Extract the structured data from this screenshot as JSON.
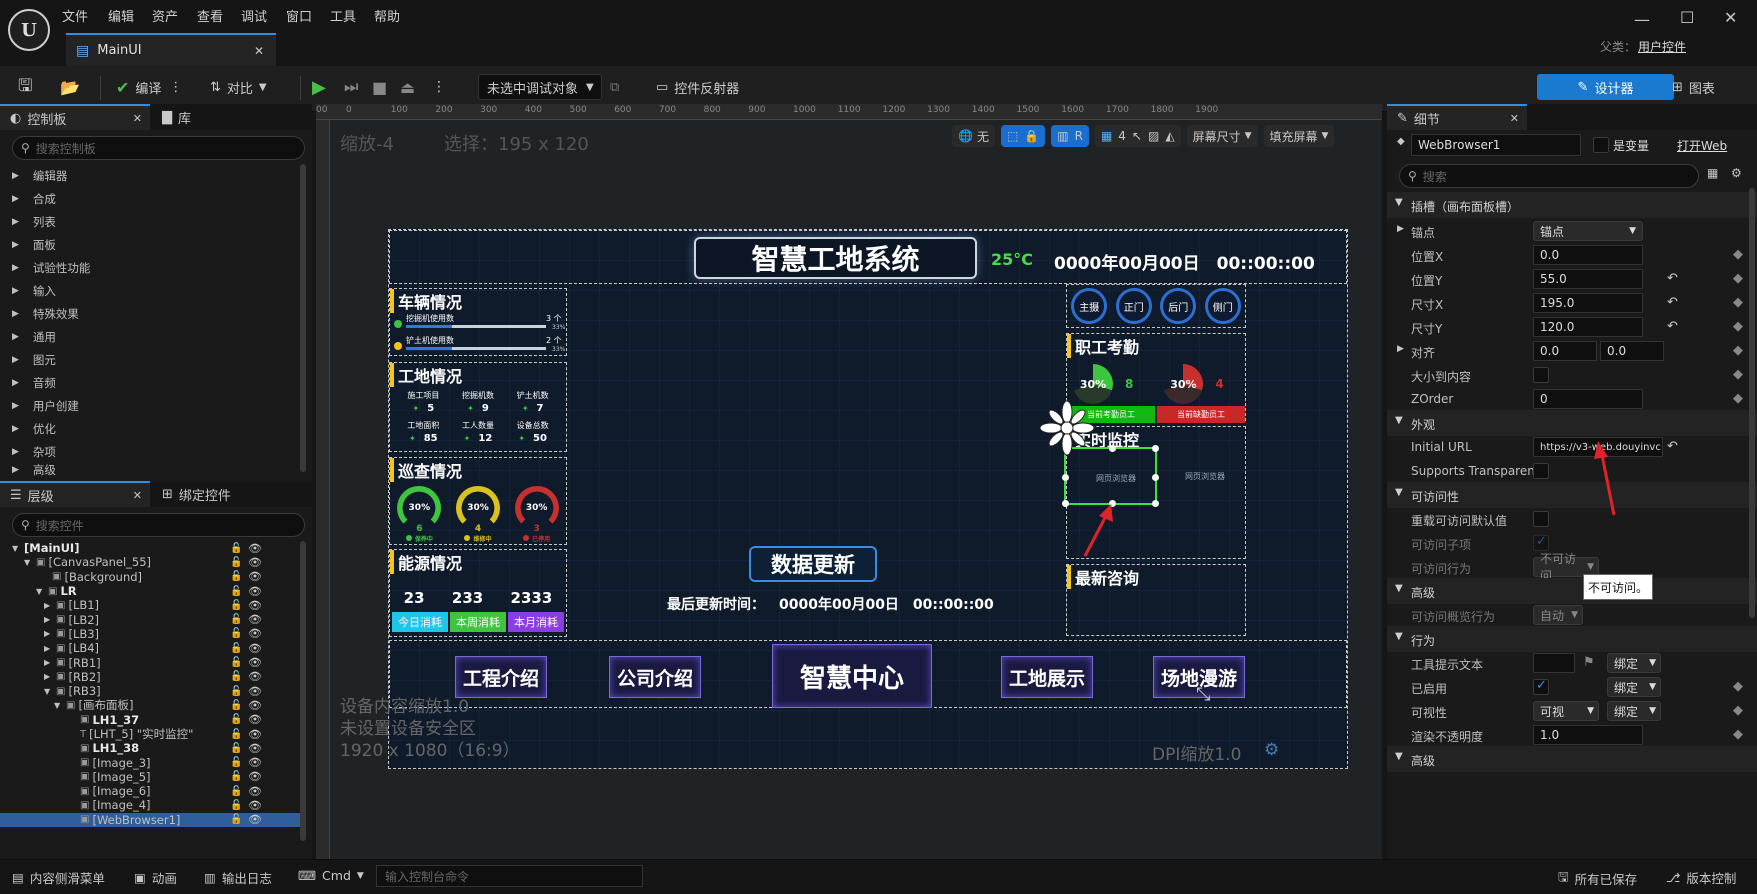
{
  "menu": {
    "items": [
      "文件",
      "编辑",
      "资产",
      "查看",
      "调试",
      "窗口",
      "工具",
      "帮助"
    ],
    "parent_label": "父类：",
    "parent_value": "用户控件",
    "window_controls": [
      "minimize",
      "maximize",
      "close"
    ]
  },
  "tab": {
    "label": "MainUI"
  },
  "toolbar": {
    "compile": "编译",
    "diff": "对比",
    "debug_select": "未选中调试对象",
    "widget_reflector": "控件反射器",
    "designer": "设计器",
    "graph": "图表"
  },
  "palette": {
    "tab_palette": "控制板",
    "tab_library": "库",
    "search_placeholder": "搜索控制板",
    "categories": [
      "编辑器",
      "合成",
      "列表",
      "面板",
      "试验性功能",
      "输入",
      "特殊效果",
      "通用",
      "图元",
      "音频",
      "用户创建",
      "优化",
      "杂项",
      "高级"
    ]
  },
  "hierarchy": {
    "tab_hierarchy": "层级",
    "tab_bind": "绑定控件",
    "search_placeholder": "搜索控件",
    "rows": [
      {
        "label": "[MainUI]",
        "bold": true
      },
      {
        "label": "[CanvasPanel_55]"
      },
      {
        "label": "[Background]"
      },
      {
        "label": "LR",
        "bold": true
      },
      {
        "label": "[LB1]"
      },
      {
        "label": "[LB2]"
      },
      {
        "label": "[LB3]"
      },
      {
        "label": "[LB4]"
      },
      {
        "label": "[RB1]"
      },
      {
        "label": "[RB2]"
      },
      {
        "label": "[RB3]"
      },
      {
        "label": "[画布面板]"
      },
      {
        "label": "LH1_37",
        "bold": true
      },
      {
        "label": "[LHT_5] \"实时监控\""
      },
      {
        "label": "LH1_38",
        "bold": true
      },
      {
        "label": "[Image_3]"
      },
      {
        "label": "[Image_5]"
      },
      {
        "label": "[Image_6]"
      },
      {
        "label": "[Image_4]"
      },
      {
        "label": "[WebBrowser1]"
      }
    ]
  },
  "viewport": {
    "zoom": "缩放-4",
    "selection": "选择：195 x 120",
    "ruler_ticks": [
      "00",
      "0",
      "100",
      "200",
      "300",
      "400",
      "500",
      "600",
      "700",
      "800",
      "900",
      "1000",
      "1100",
      "1200",
      "1300",
      "1400",
      "1500",
      "1600",
      "1700",
      "1800",
      "1900"
    ],
    "toolbar_none": "无",
    "toolbar_r": "R",
    "toolbar_grid": "4",
    "screen_size": "屏幕尺寸",
    "fill_screen": "填充屏幕",
    "info_lines": [
      "设备内容缩放1.0",
      "未设置设备安全区",
      "1920 x 1080（16:9）"
    ],
    "dpi": "DPI缩放1.0"
  },
  "design": {
    "title": "智慧工地系统",
    "temp": "25°C",
    "datetime": "0000年00月00日　00::00::00",
    "vehicles": {
      "title": "车辆情况",
      "items": [
        {
          "label": "挖掘机使用数",
          "count": "3 个",
          "pct": "33%",
          "fill": 0.33
        },
        {
          "label": "铲土机使用数",
          "count": "2 个",
          "pct": "33%",
          "fill": 0.33
        }
      ]
    },
    "site": {
      "title": "工地情况",
      "items": [
        {
          "label": "施工项目",
          "value": "5"
        },
        {
          "label": "挖掘机数",
          "value": "9"
        },
        {
          "label": "铲土机数",
          "value": "7"
        },
        {
          "label": "工地面积",
          "value": "85"
        },
        {
          "label": "工人数量",
          "value": "12"
        },
        {
          "label": "设备总数",
          "value": "50"
        }
      ]
    },
    "patrol": {
      "title": "巡查情况",
      "gauges": [
        {
          "pct": "30%",
          "value": "6",
          "label": "保养中",
          "color": "#3ec43e"
        },
        {
          "pct": "30%",
          "value": "4",
          "label": "维修中",
          "color": "#d8c21e"
        },
        {
          "pct": "30%",
          "value": "3",
          "label": "已停用",
          "color": "#c83030"
        }
      ]
    },
    "energy": {
      "title": "能源情况",
      "values": [
        "23",
        "233",
        "2333"
      ],
      "labels": [
        "今日消耗",
        "本周消耗",
        "本月消耗"
      ],
      "colors": [
        "#1fc6e8",
        "#3ec43e",
        "#8a3ee0"
      ]
    },
    "cams": [
      "主摄",
      "正门",
      "后门",
      "侧门"
    ],
    "attendance": {
      "title": "职工考勤",
      "g1": {
        "pct": "30%",
        "value": "8"
      },
      "g2": {
        "pct": "30%",
        "value": "4"
      },
      "b1": "当前考勤员工",
      "b2": "当前缺勤员工"
    },
    "monitor": {
      "title": "实时监控",
      "web1": "网页浏览器",
      "web2": "网页浏览器"
    },
    "news": {
      "title": "最新咨询"
    },
    "update_button": "数据更新",
    "last_update_label": "最后更新时间：",
    "last_update_value": "0000年00月00日　00::00::00",
    "nav": [
      "工程介绍",
      "公司介绍",
      "智慧中心",
      "工地展示",
      "场地漫游"
    ]
  },
  "details": {
    "tab": "细节",
    "name": "WebBrowser1",
    "is_variable": "是变量",
    "open_web": "打开Web",
    "search_placeholder": "搜索",
    "slot_section": "插槽（画布面板槽）",
    "anchor_label": "锚点",
    "anchor_value": "锚点",
    "pos_x_label": "位置X",
    "pos_x": "0.0",
    "pos_y_label": "位置Y",
    "pos_y": "55.0",
    "size_x_label": "尺寸X",
    "size_x": "195.0",
    "size_y_label": "尺寸Y",
    "size_y": "120.0",
    "align_label": "对齐",
    "align_x": "0.0",
    "align_y": "0.0",
    "size_to_content": "大小到内容",
    "zorder_label": "ZOrder",
    "zorder": "0",
    "appearance_section": "外观",
    "initial_url_label": "Initial URL",
    "initial_url": "https://v3-web.douyinvc",
    "supports_transparency": "Supports Transparen...",
    "access_section": "可访问性",
    "override_access": "重载可访问默认值",
    "access_children": "可访问子项",
    "access_behavior": "可访问行为",
    "access_behavior_value": "不可访问",
    "tooltip_text": "不可访问。",
    "advanced_section": "高级",
    "access_summary": "可访问概览行为",
    "auto": "自动",
    "behavior_section": "行为",
    "tooltip_label": "工具提示文本",
    "enabled": "已启用",
    "visibility": "可视性",
    "visibility_value": "可视",
    "opacity_label": "渲染不透明度",
    "opacity": "1.0",
    "bind": "绑定",
    "advanced2": "高级"
  },
  "status": {
    "content_drawer": "内容侧滑菜单",
    "animation": "动画",
    "output_log": "输出日志",
    "cmd": "Cmd",
    "cmd_placeholder": "输入控制台命令",
    "saved": "所有已保存",
    "version": "版本控制"
  }
}
